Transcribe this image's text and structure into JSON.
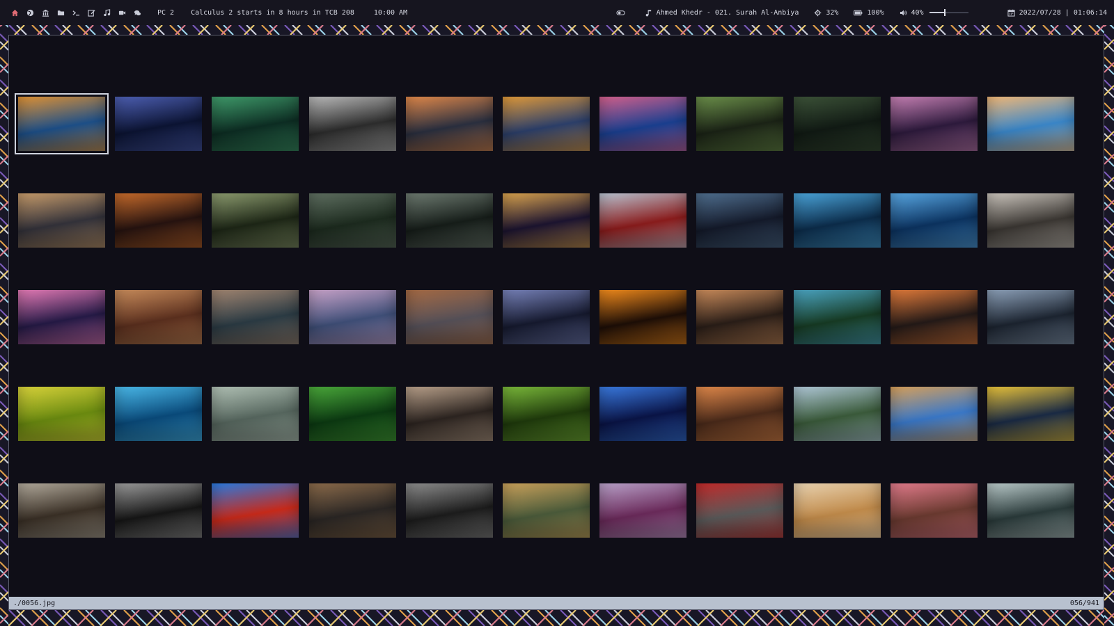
{
  "topbar": {
    "launchers": [
      {
        "icon": "home-icon",
        "color": "#e06c75"
      },
      {
        "icon": "globe-icon",
        "color": "#c9ccd8"
      },
      {
        "icon": "bank-icon",
        "color": "#c9ccd8"
      },
      {
        "icon": "folder-icon",
        "color": "#c9ccd8"
      },
      {
        "icon": "terminal-icon",
        "color": "#c9ccd8"
      },
      {
        "icon": "edit-icon",
        "color": "#c9ccd8"
      },
      {
        "icon": "music-icon",
        "color": "#c9ccd8"
      },
      {
        "icon": "video-icon",
        "color": "#c9ccd8"
      },
      {
        "icon": "chat-icon",
        "color": "#c9ccd8"
      }
    ],
    "workspace": "PC 2",
    "reminder": "Calculus 2 starts in 8 hours in TCB 208",
    "next_time": "10:00 AM",
    "now_playing": "Ahmed Khedr - 021. Surah Al-Anbiya",
    "cpu": "32%",
    "battery": "100%",
    "volume": "40%",
    "volume_level": 0.4,
    "datetime": "2022/07/28 | 01:06:14"
  },
  "viewer": {
    "selected_index": 0,
    "thumbnails": [
      {
        "c1": "#1d4f88",
        "c2": "#e09234"
      },
      {
        "c1": "#0c1433",
        "c2": "#4d5fb2"
      },
      {
        "c1": "#0d2d23",
        "c2": "#3f9a6a"
      },
      {
        "c1": "#2c2c2c",
        "c2": "#b9b9b9"
      },
      {
        "c1": "#2a2f3f",
        "c2": "#e0884a"
      },
      {
        "c1": "#2c3f6a",
        "c2": "#e09a3a"
      },
      {
        "c1": "#1a3f8f",
        "c2": "#d3608c"
      },
      {
        "c1": "#1b2316",
        "c2": "#6b8f4a"
      },
      {
        "c1": "#111a14",
        "c2": "#3c5238"
      },
      {
        "c1": "#2d1a3c",
        "c2": "#c47fb2"
      },
      {
        "c1": "#3a86c8",
        "c2": "#f2b877"
      },
      {
        "c1": "#33323a",
        "c2": "#c59a6a"
      },
      {
        "c1": "#261310",
        "c2": "#c56a2b"
      },
      {
        "c1": "#1d2616",
        "c2": "#8b9a6e"
      },
      {
        "c1": "#1c2a1e",
        "c2": "#5e6e60"
      },
      {
        "c1": "#161d19",
        "c2": "#6d7a70"
      },
      {
        "c1": "#1c1430",
        "c2": "#d8a24e"
      },
      {
        "c1": "#8a1c1c",
        "c2": "#b8c2d0"
      },
      {
        "c1": "#141a2a",
        "c2": "#4f6e8e"
      },
      {
        "c1": "#0c2c4a",
        "c2": "#4aa3d8"
      },
      {
        "c1": "#0c3360",
        "c2": "#57a5e0"
      },
      {
        "c1": "#3a3632",
        "c2": "#c9c3bb"
      },
      {
        "c1": "#251a46",
        "c2": "#e37ab5"
      },
      {
        "c1": "#5a2f1e",
        "c2": "#c68a5a"
      },
      {
        "c1": "#2b3b44",
        "c2": "#a08470"
      },
      {
        "c1": "#3f4f78",
        "c2": "#c7a2c8"
      },
      {
        "c1": "#555058",
        "c2": "#a56a44"
      },
      {
        "c1": "#161a2f",
        "c2": "#7681b8"
      },
      {
        "c1": "#1d0e07",
        "c2": "#f08a1c"
      },
      {
        "c1": "#2a1e18",
        "c2": "#c88a5a"
      },
      {
        "c1": "#173b24",
        "c2": "#4aa3c0"
      },
      {
        "c1": "#241a18",
        "c2": "#e07a3a"
      },
      {
        "c1": "#1c2430",
        "c2": "#8ca0b8"
      },
      {
        "c1": "#6a8a10",
        "c2": "#d8d23a"
      },
      {
        "c1": "#0a4a7a",
        "c2": "#4ab8e8"
      },
      {
        "c1": "#56665e",
        "c2": "#b0c0b4"
      },
      {
        "c1": "#0c3a12",
        "c2": "#4aa83a"
      },
      {
        "c1": "#2c2420",
        "c2": "#b8a08a"
      },
      {
        "c1": "#1f3a0c",
        "c2": "#7ab83a"
      },
      {
        "c1": "#0a1446",
        "c2": "#3a7ae0"
      },
      {
        "c1": "#4a2a1a",
        "c2": "#e0884a"
      },
      {
        "c1": "#3a5a3a",
        "c2": "#b0c8d8"
      },
      {
        "c1": "#3a78c8",
        "c2": "#d8a05a"
      },
      {
        "c1": "#1a2a44",
        "c2": "#e8c23a"
      },
      {
        "c1": "#3a3026",
        "c2": "#b0a89a"
      },
      {
        "c1": "#161616",
        "c2": "#9a9a9a"
      },
      {
        "c1": "#c82a1a",
        "c2": "#2a7ae0"
      },
      {
        "c1": "#2a2624",
        "c2": "#8a6a4a"
      },
      {
        "c1": "#1c1c1c",
        "c2": "#8c8c8c"
      },
      {
        "c1": "#4a5a3a",
        "c2": "#c8a05a"
      },
      {
        "c1": "#6a2a5a",
        "c2": "#b8a0c8"
      },
      {
        "c1": "#5a5a5a",
        "c2": "#c02a2a"
      },
      {
        "c1": "#c08a4a",
        "c2": "#e8d2b0"
      },
      {
        "c1": "#6a3a30",
        "c2": "#e07a8a"
      },
      {
        "c1": "#2a3a3a",
        "c2": "#b8c8c8"
      }
    ]
  },
  "status": {
    "filename": "./0056.jpg",
    "position": "056/941"
  }
}
